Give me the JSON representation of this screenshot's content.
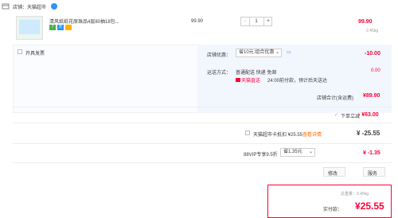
{
  "shop": {
    "label": "店铺：",
    "name": "天猫超市"
  },
  "item": {
    "title": "清风纸纸花原珠品4层80抽18包...",
    "unit_price": "99.90",
    "qty": "1",
    "total": "99.90",
    "weight": "2.45kg",
    "tags": [
      "7",
      "天"
    ]
  },
  "invoice": {
    "label": "开具发票"
  },
  "discount": {
    "label": "店铺优惠：",
    "select": "省10元:组合优惠",
    "amount": "-10.00"
  },
  "shipping": {
    "label": "运送方式：",
    "method": "普通配送 快递 免邮",
    "badge": "天猫直送",
    "note": "24:00前付款，预计后天送达",
    "fee": "0.00"
  },
  "shop_total": {
    "label": "店铺合计(含运费)",
    "value": "¥89.90"
  },
  "cross_discount": {
    "label": "下单立减",
    "value": "- ¥63.00"
  },
  "coupon": {
    "label": "天猫超市卡抵扣 ¥25.55",
    "link": "查看详情",
    "value": "¥ -25.55"
  },
  "vip": {
    "label": "88VIP专享9.5折",
    "select": "省1.35元",
    "value": "¥ -1.35"
  },
  "footer": {
    "left": "修改",
    "right": "服务",
    "weight_label": "总重量：2.45kg",
    "pay_label": "实付款：",
    "pay_value": "25.55"
  },
  "colors": {
    "accent": "#ff0036",
    "tag_green": "#4caf50",
    "tag_blue": "#2196f3"
  }
}
